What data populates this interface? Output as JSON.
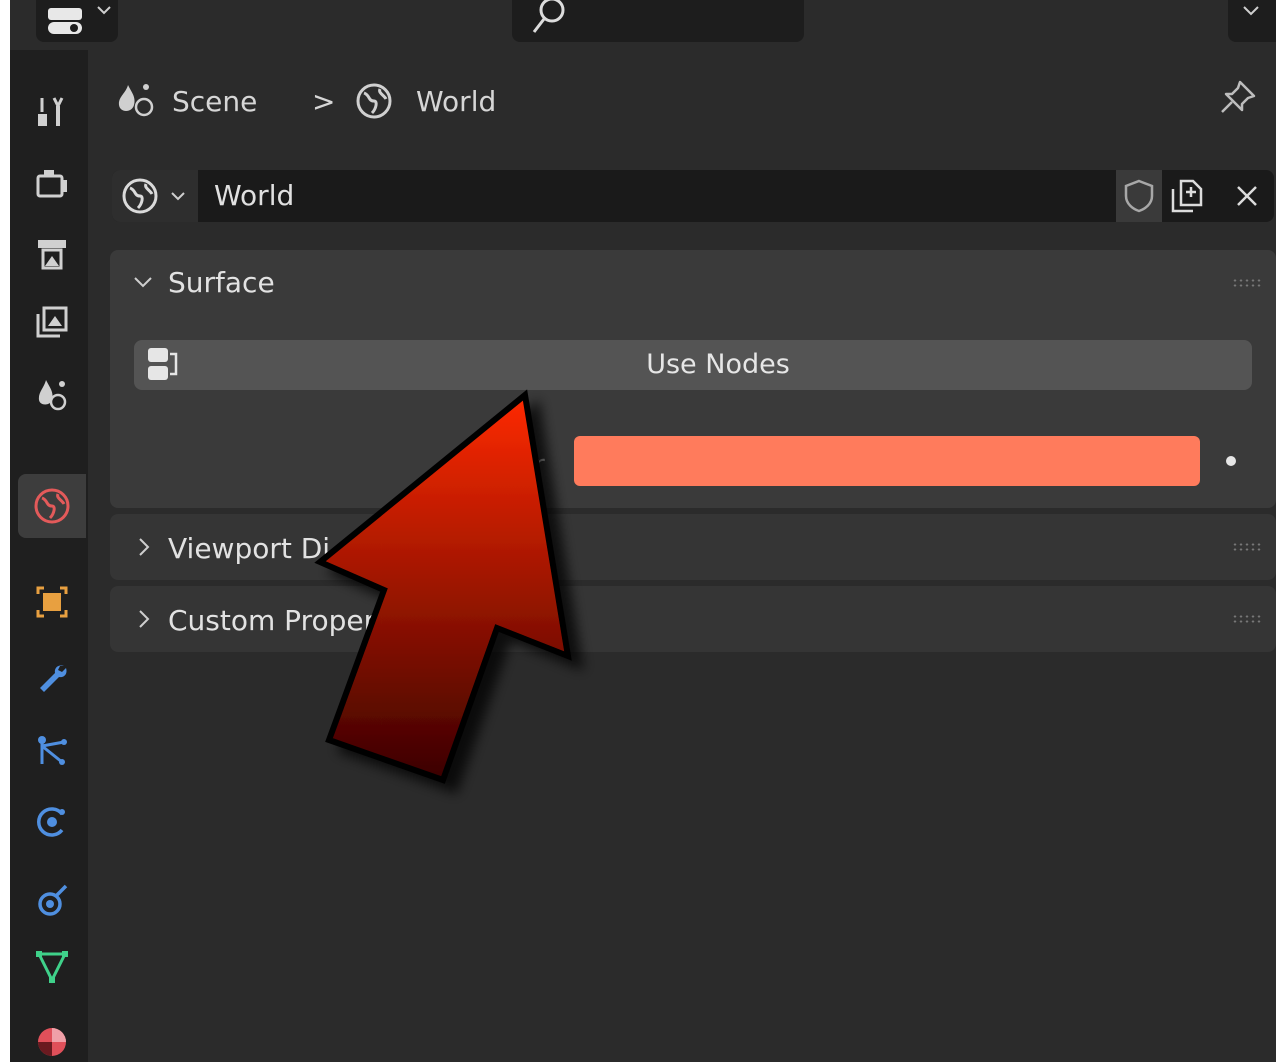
{
  "breadcrumb": {
    "scene_label": "Scene",
    "separator": ">",
    "world_label": "World"
  },
  "datablock": {
    "name": "World"
  },
  "panels": {
    "surface": {
      "title": "Surface",
      "use_nodes_label": "Use Nodes",
      "color_label": "r",
      "color_value": "#ff7b5c"
    },
    "viewport_display": {
      "title": "Viewport Di"
    },
    "custom_properties": {
      "title": "Custom Propert"
    }
  },
  "tabs": [
    "tool-tab",
    "render-tab",
    "output-tab",
    "view-layer-tab",
    "scene-tab",
    "world-tab",
    "object-tab",
    "modifiers-tab",
    "particles-tab",
    "physics-tab",
    "constraints-tab",
    "data-tab",
    "material-tab"
  ],
  "active_tab": "world-tab",
  "colors": {
    "accent_active_tab": "#3d3d3d",
    "world_icon": "#e35a5a",
    "arrow_top": "#ff2a00",
    "arrow_bottom": "#3a0000"
  }
}
